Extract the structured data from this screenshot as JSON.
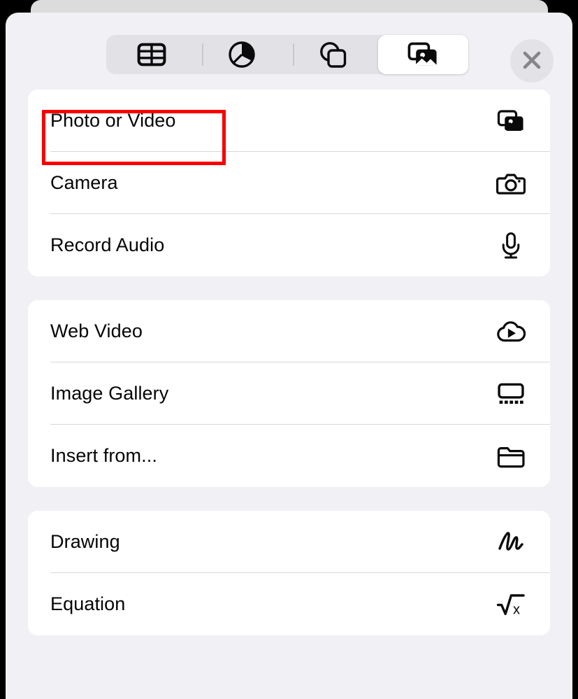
{
  "window": {
    "background_color": "#000000",
    "sheet_color": "#f1f0f5",
    "back_sheet_color": "#dcdcdc",
    "card_color": "#ffffff"
  },
  "header": {
    "segmented_control": {
      "background_color": "#e2e1e6",
      "selected_index": 3,
      "segments": [
        {
          "icon": "table-icon",
          "name": "table",
          "selected": false
        },
        {
          "icon": "pie-chart-icon",
          "name": "chart",
          "selected": false
        },
        {
          "icon": "shapes-icon",
          "name": "shape",
          "selected": false
        },
        {
          "icon": "media-icon",
          "name": "media",
          "selected": true
        }
      ]
    },
    "close_button": {
      "icon": "close-icon",
      "background_color": "#e3e2e7",
      "glyph_color": "#88878d"
    }
  },
  "annotation": {
    "type": "highlight-box",
    "color": "#f70000",
    "target": "Photo or Video"
  },
  "groups": [
    {
      "name": "capture-group",
      "rows": [
        {
          "label": "Photo or Video",
          "icon": "photo-video-icon",
          "highlighted": true
        },
        {
          "label": "Camera",
          "icon": "camera-icon",
          "highlighted": false
        },
        {
          "label": "Record Audio",
          "icon": "microphone-icon",
          "highlighted": false
        }
      ]
    },
    {
      "name": "media-group",
      "rows": [
        {
          "label": "Web Video",
          "icon": "cloud-play-icon",
          "highlighted": false
        },
        {
          "label": "Image Gallery",
          "icon": "image-gallery-icon",
          "highlighted": false
        },
        {
          "label": "Insert from...",
          "icon": "folder-icon",
          "highlighted": false
        }
      ]
    },
    {
      "name": "markup-group",
      "rows": [
        {
          "label": "Drawing",
          "icon": "scribble-icon",
          "highlighted": false
        },
        {
          "label": "Equation",
          "icon": "square-root-icon",
          "highlighted": false
        }
      ]
    }
  ]
}
